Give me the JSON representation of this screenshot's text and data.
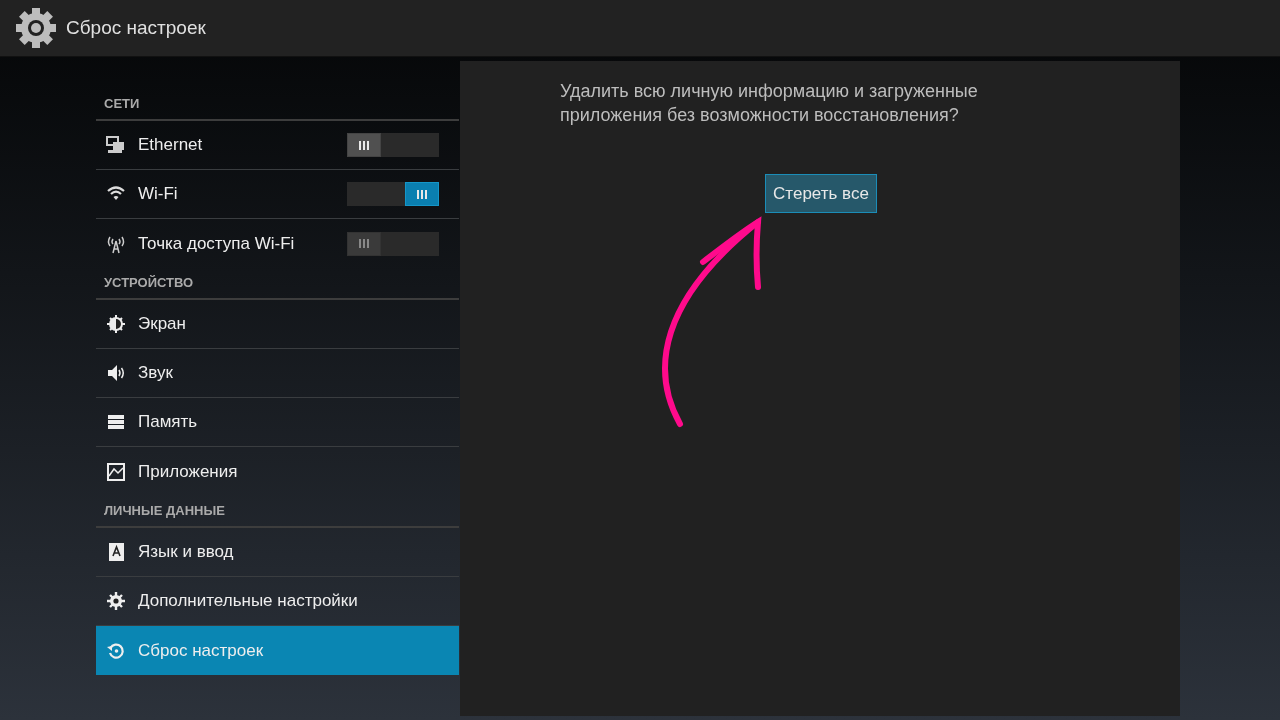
{
  "action_bar": {
    "title": "Сброс настроек"
  },
  "sidebar": {
    "sections": [
      {
        "header": "СЕТИ",
        "items": [
          {
            "label": "Ethernet",
            "selected": false,
            "toggle": {
              "on": false,
              "disabled": false
            }
          },
          {
            "label": "Wi-Fi",
            "selected": false,
            "toggle": {
              "on": true,
              "disabled": false
            }
          },
          {
            "label": "Точка доступа Wi-Fi",
            "selected": false,
            "toggle": {
              "on": false,
              "disabled": true
            }
          }
        ]
      },
      {
        "header": "УСТРОЙСТВО",
        "items": [
          {
            "label": "Экран",
            "selected": false
          },
          {
            "label": "Звук",
            "selected": false
          },
          {
            "label": "Память",
            "selected": false
          },
          {
            "label": "Приложения",
            "selected": false
          }
        ]
      },
      {
        "header": "ЛИЧНЫЕ ДАННЫЕ",
        "items": [
          {
            "label": "Язык и ввод",
            "selected": false
          },
          {
            "label": "Дополнительные настройки",
            "selected": false
          },
          {
            "label": "Сброс настроек",
            "selected": true
          }
        ]
      }
    ]
  },
  "content": {
    "message": "Удалить всю личную информацию и загруженные приложения без возможности восстановления?",
    "button": "Стереть все"
  }
}
